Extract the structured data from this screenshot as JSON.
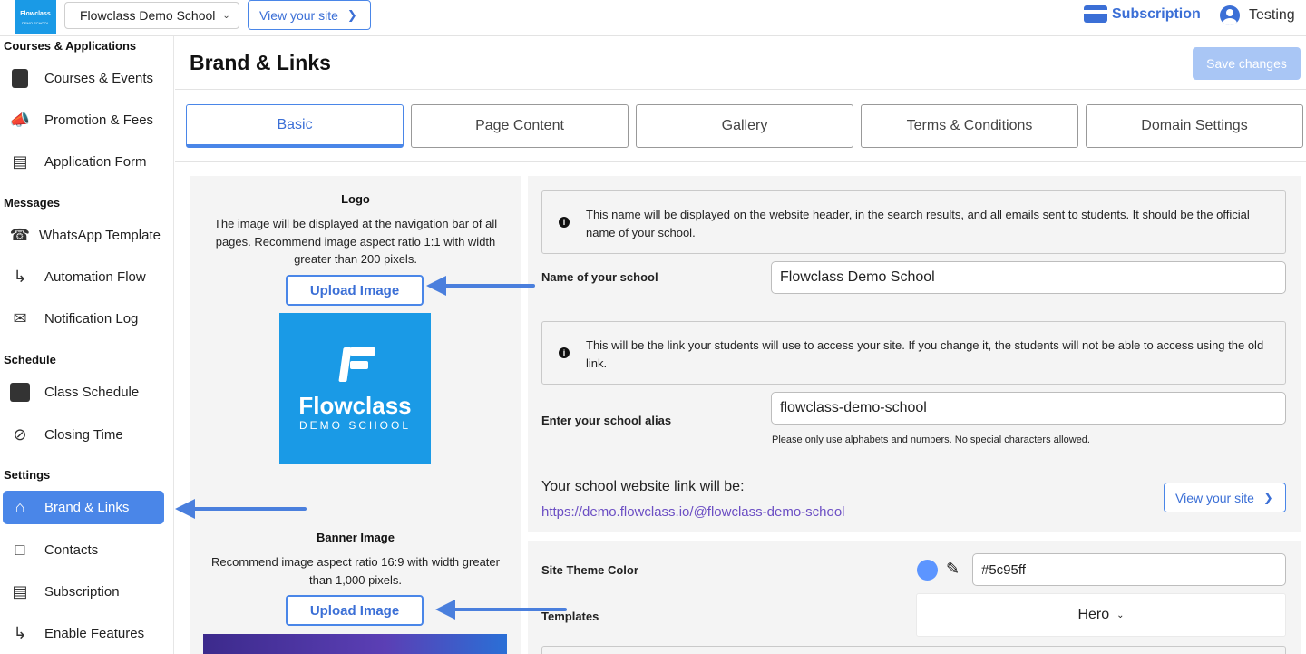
{
  "topbar": {
    "logo_word": "Flowclass",
    "logo_sub": "DEMO SCHOOL",
    "school_name": "Flowclass Demo School",
    "view_site": "View your site",
    "subscription": "Subscription",
    "user_name": "Testing"
  },
  "sidebar": {
    "sections": {
      "courses": "Courses & Applications",
      "messages": "Messages",
      "schedule": "Schedule",
      "settings": "Settings"
    },
    "items": {
      "courses_events": "Courses & Events",
      "promotion_fees": "Promotion & Fees",
      "application_form": "Application Form",
      "whatsapp_template": "WhatsApp Template",
      "automation_flow": "Automation Flow",
      "notification_log": "Notification Log",
      "class_schedule": "Class Schedule",
      "closing_time": "Closing Time",
      "brand_links": "Brand & Links",
      "contacts": "Contacts",
      "subscription": "Subscription",
      "enable_features": "Enable Features"
    },
    "active": "Brand & Links"
  },
  "main": {
    "title": "Brand & Links",
    "save_label": "Save changes",
    "tabs": {
      "basic": "Basic",
      "page_content": "Page Content",
      "gallery": "Gallery",
      "terms": "Terms & Conditions",
      "domain": "Domain Settings"
    },
    "active_tab": "Basic"
  },
  "logo_section": {
    "title": "Logo",
    "description": "The image will be displayed at the navigation bar of all pages. Recommend image aspect ratio 1:1 with width greater than 200 pixels.",
    "upload_label": "Upload Image",
    "preview_word": "Flowclass",
    "preview_sub": "DEMO SCHOOL"
  },
  "banner_section": {
    "title": "Banner Image",
    "description": "Recommend image aspect ratio 16:9 with width greater than 1,000 pixels.",
    "upload_label": "Upload Image"
  },
  "school_form": {
    "name_info": "This name will be displayed on the website header, in the search results, and all emails sent to students. It should be the official name of your school.",
    "name_label": "Name of your school",
    "name_value": "Flowclass Demo School",
    "alias_info": "This will be the link your students will use to access your site. If you change it, the students will not be able to access using the old link.",
    "alias_label": "Enter your school alias",
    "alias_value": "flowclass-demo-school",
    "alias_hint": "Please only use alphabets and numbers. No special characters allowed.",
    "link_label": "Your school website link will be:",
    "link_value": "https://demo.flowclass.io/@flowclass-demo-school",
    "view_site": "View your site"
  },
  "theme": {
    "color_label": "Site Theme Color",
    "color_value": "#5c95ff",
    "templates_label": "Templates",
    "template_value": "Hero"
  },
  "colors": {
    "accent": "#4a86e8",
    "theme": "#5c95ff",
    "logo_bg": "#1a9ae6",
    "save_disabled": "#a9c6f5"
  }
}
